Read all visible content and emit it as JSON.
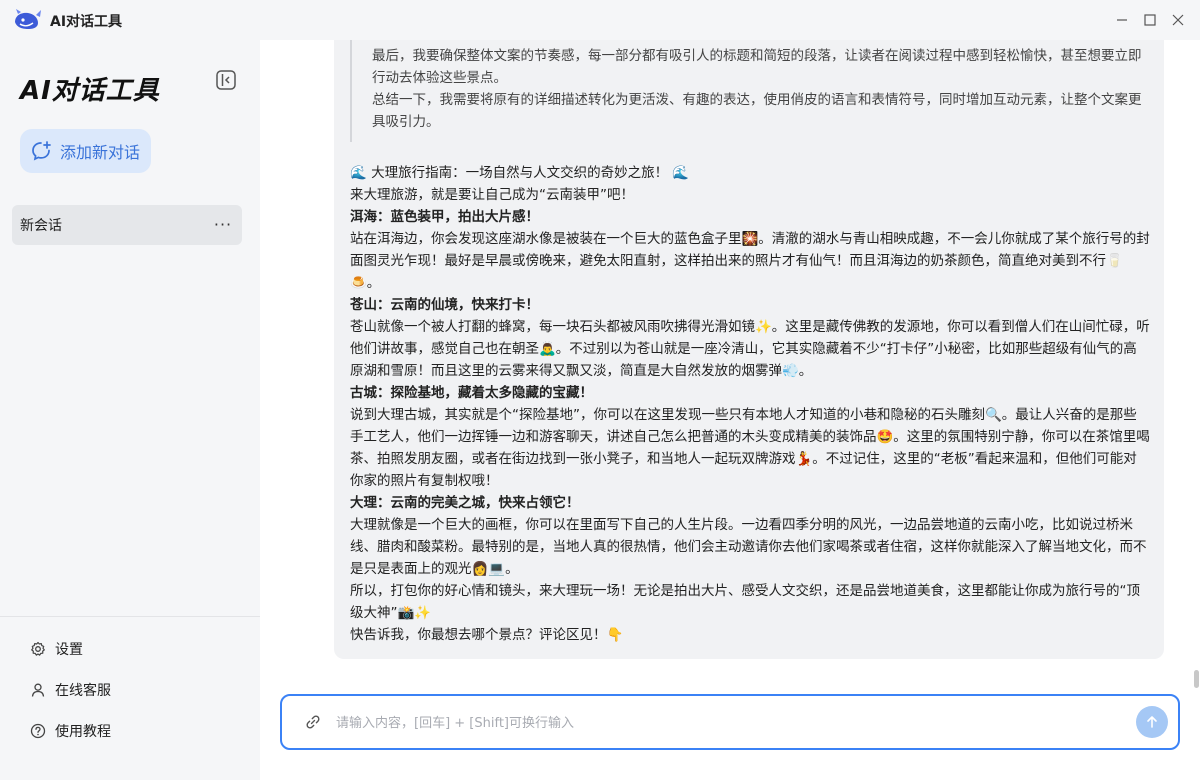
{
  "app": {
    "title": "AI对话工具"
  },
  "sidebar": {
    "title": "AI对话工具",
    "new_chat_label": "添加新对话",
    "sessions": [
      {
        "label": "新会话",
        "more": "···"
      }
    ],
    "bottom_items": [
      {
        "label": "设置",
        "icon": "gear-icon"
      },
      {
        "label": "在线客服",
        "icon": "user-icon"
      },
      {
        "label": "使用教程",
        "icon": "help-circle-icon"
      }
    ]
  },
  "chat": {
    "quote_lines": [
      "最后，我要确保整体文案的节奏感，每一部分都有吸引人的标题和简短的段落，让读者在阅读过程中感到轻松愉快，甚至想要立即行动去体验这些景点。",
      "总结一下，我需要将原有的详细描述转化为更活泼、有趣的表达，使用俏皮的语言和表情符号，同时增加互动元素，让整个文案更具吸引力。"
    ],
    "answer": {
      "title": "🌊 大理旅行指南：一场自然与人文交织的奇妙之旅！ 🌊",
      "intro": "来大理旅游，就是要让自己成为“云南装甲”吧！",
      "sections": [
        {
          "heading": "洱海：蓝色装甲，拍出大片感！",
          "body": "站在洱海边，你会发现这座湖水像是被装在一个巨大的蓝色盒子里🎇。清澈的湖水与青山相映成趣，不一会儿你就成了某个旅行号的封面图灵光乍现！最好是早晨或傍晚来，避免太阳直射，这样拍出来的照片才有仙气！而且洱海边的奶茶颜色，简直绝对美到不行🥛🍮。"
        },
        {
          "heading": "苍山：云南的仙境，快来打卡！",
          "body": "苍山就像一个被人打翻的蜂窝，每一块石头都被风雨吹拂得光滑如镜✨。这里是藏传佛教的发源地，你可以看到僧人们在山间忙碌，听他们讲故事，感觉自己也在朝圣🙇‍♂️。不过别以为苍山就是一座冷清山，它其实隐藏着不少“打卡仔”小秘密，比如那些超级有仙气的高原湖和雪原！而且这里的云雾来得又飘又淡，简直是大自然发放的烟雾弹💨。"
        },
        {
          "heading": "古城：探险基地，藏着太多隐藏的宝藏！",
          "body": "说到大理古城，其实就是个“探险基地”，你可以在这里发现一些只有本地人才知道的小巷和隐秘的石头雕刻🔍。最让人兴奋的是那些手工艺人，他们一边挥锤一边和游客聊天，讲述自己怎么把普通的木头变成精美的装饰品🤩。这里的氛围特别宁静，你可以在茶馆里喝茶、拍照发朋友圈，或者在街边找到一张小凳子，和当地人一起玩双牌游戏💃。不过记住，这里的“老板”看起来温和，但他们可能对你家的照片有复制权哦！"
        },
        {
          "heading": "大理：云南的完美之城，快来占领它！",
          "body": "大理就像是一个巨大的画框，你可以在里面写下自己的人生片段。一边看四季分明的风光，一边品尝地道的云南小吃，比如说过桥米线、腊肉和酸菜粉。最特别的是，当地人真的很热情，他们会主动邀请你去他们家喝茶或者住宿，这样你就能深入了解当地文化，而不是只是表面上的观光👩💻。"
        }
      ],
      "closing": "所以，打包你的好心情和镜头，来大理玩一场！无论是拍出大片、感受人文交织，还是品尝地道美食，这里都能让你成为旅行号的“顶级大神”📸✨",
      "question": "快告诉我，你最想去哪个景点？评论区见！👇"
    },
    "input": {
      "placeholder": "请输入内容，[回车] + [Shift]可换行输入",
      "value": ""
    }
  },
  "colors": {
    "accent": "#3b82f6",
    "new_chat_bg": "#dbe8fb",
    "sidebar_bg": "#f5f6f8",
    "bubble_bg": "#f1f2f4"
  }
}
